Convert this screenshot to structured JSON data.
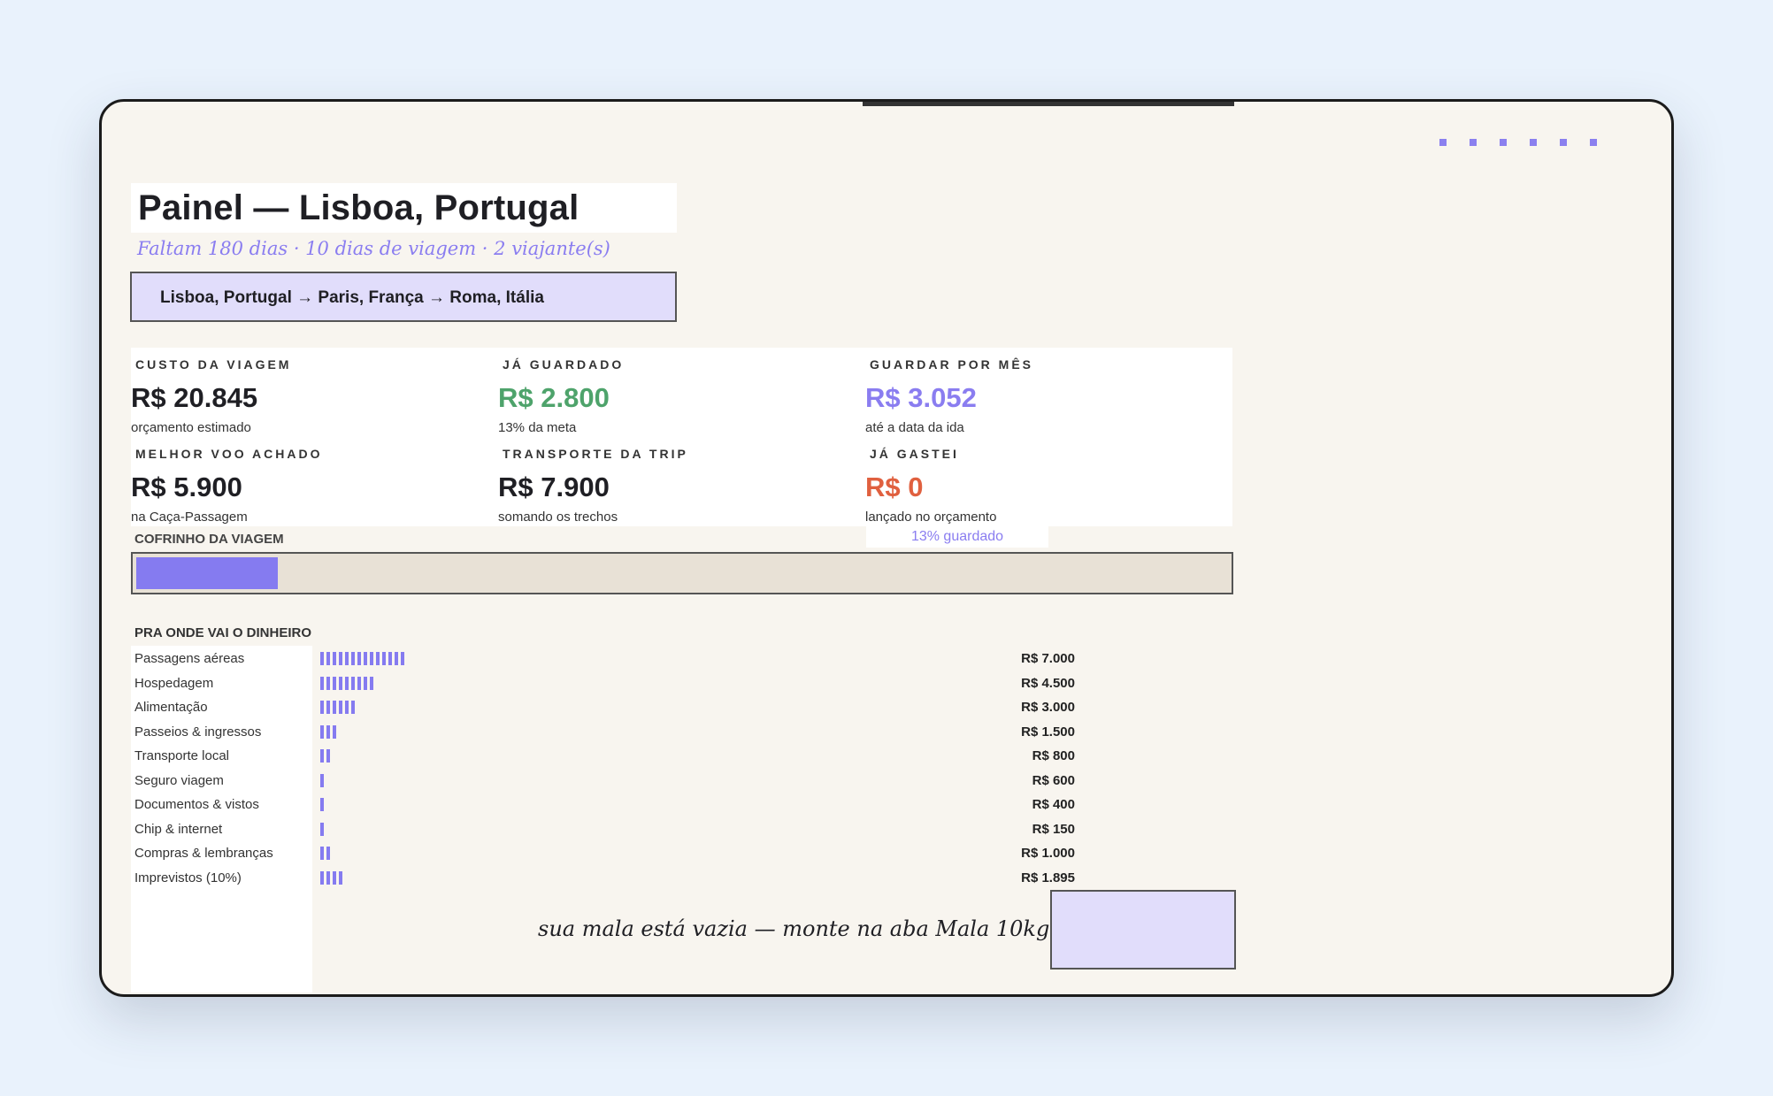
{
  "header": {
    "title": "Painel — Lisboa, Portugal",
    "subtitle": "Faltam 180 dias · 10 dias de viagem · 2 viajante(s)",
    "route": "Lisboa, Portugal → Paris, França → Roma, Itália"
  },
  "stats": [
    {
      "label": "CUSTO DA VIAGEM",
      "value": "R$ 20.845",
      "note": "orçamento estimado",
      "color": "#1f1f24"
    },
    {
      "label": "JÁ GUARDADO",
      "value": "R$ 2.800",
      "note": "13% da meta",
      "color": "#4ea36b"
    },
    {
      "label": "GUARDAR POR MÊS",
      "value": "R$ 3.052",
      "note": "até a data da ida",
      "color": "#8a7df0"
    },
    {
      "label": "MELHOR VOO ACHADO",
      "value": "R$ 5.900",
      "note": "na Caça-Passagem",
      "color": "#1f1f24"
    },
    {
      "label": "TRANSPORTE DA TRIP",
      "value": "R$ 7.900",
      "note": "somando os trechos",
      "color": "#1f1f24"
    },
    {
      "label": "JÁ GASTEI",
      "value": "R$ 0",
      "note": "lançado no orçamento",
      "color": "#e0603f"
    }
  ],
  "piggy": {
    "label": "COFRINHO DA VIAGEM",
    "percent_text": "13% guardado",
    "progress": 0.13
  },
  "breakdown": {
    "title": "PRA ONDE VAI O DINHEIRO",
    "items": [
      {
        "label": "Passagens aéreas",
        "amount": "R$ 7.000",
        "value": 7000
      },
      {
        "label": "Hospedagem",
        "amount": "R$ 4.500",
        "value": 4500
      },
      {
        "label": "Alimentação",
        "amount": "R$ 3.000",
        "value": 3000
      },
      {
        "label": "Passeios & ingressos",
        "amount": "R$ 1.500",
        "value": 1500
      },
      {
        "label": "Transporte local",
        "amount": "R$ 800",
        "value": 800
      },
      {
        "label": "Seguro viagem",
        "amount": "R$ 600",
        "value": 600
      },
      {
        "label": "Documentos & vistos",
        "amount": "R$ 400",
        "value": 400
      },
      {
        "label": "Chip & internet",
        "amount": "R$ 150",
        "value": 150
      },
      {
        "label": "Compras & lembranças",
        "amount": "R$ 1.000",
        "value": 1000
      },
      {
        "label": "Imprevistos (10%)",
        "amount": "R$ 1.895",
        "value": 1895
      }
    ]
  },
  "footer": {
    "note": "sua mala está vazia — monte na aba Mala 10kg"
  },
  "colors": {
    "accent": "#857bf0",
    "background": "#f8f5ef",
    "saved": "#4ea36b",
    "spent": "#e0603f"
  }
}
